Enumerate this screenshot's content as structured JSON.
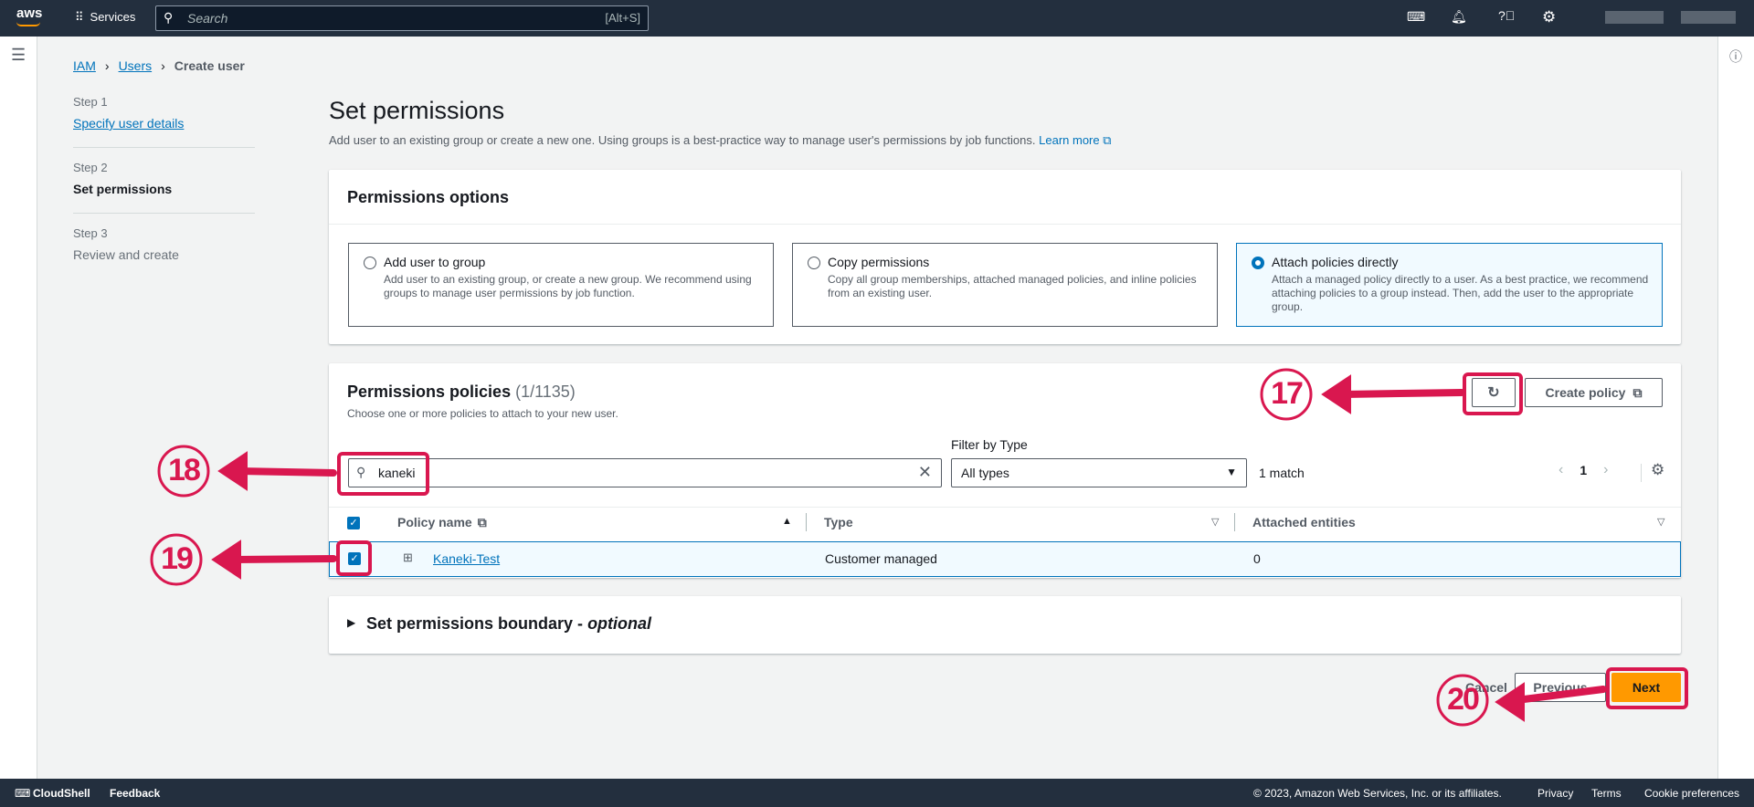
{
  "topnav": {
    "logo": "aws",
    "services": "Services",
    "search_placeholder": "Search",
    "search_shortcut": "[Alt+S]"
  },
  "breadcrumb": [
    "IAM",
    "Users",
    "Create user"
  ],
  "steps": [
    {
      "num": "Step 1",
      "label": "Specify user details"
    },
    {
      "num": "Step 2",
      "label": "Set permissions"
    },
    {
      "num": "Step 3",
      "label": "Review and create"
    }
  ],
  "page": {
    "title": "Set permissions",
    "description": "Add user to an existing group or create a new one. Using groups is a best-practice way to manage user's permissions by job functions.",
    "learn_more": "Learn more"
  },
  "options": {
    "title": "Permissions options",
    "cards": [
      {
        "label": "Add user to group",
        "desc": "Add user to an existing group, or create a new group. We recommend using groups to manage user permissions by job function.",
        "selected": false
      },
      {
        "label": "Copy permissions",
        "desc": "Copy all group memberships, attached managed policies, and inline policies from an existing user.",
        "selected": false
      },
      {
        "label": "Attach policies directly",
        "desc": "Attach a managed policy directly to a user. As a best practice, we recommend attaching policies to a group instead. Then, add the user to the appropriate group.",
        "selected": true
      }
    ]
  },
  "policies": {
    "title": "Permissions policies",
    "count": "(1/1135)",
    "subtitle": "Choose one or more policies to attach to your new user.",
    "create_policy": "Create policy",
    "filter_label": "Filter by Type",
    "search_value": "kaneki",
    "filter_value": "All types",
    "match": "1 match",
    "page": "1",
    "columns": [
      "Policy name",
      "Type",
      "Attached entities"
    ],
    "rows": [
      {
        "name": "Kaneki-Test",
        "type": "Customer managed",
        "entities": "0",
        "checked": true
      }
    ]
  },
  "boundary": {
    "title": "Set permissions boundary - ",
    "optional": "optional"
  },
  "actions": {
    "cancel": "Cancel",
    "previous": "Previous",
    "next": "Next"
  },
  "footer": {
    "cloudshell": "CloudShell",
    "feedback": "Feedback",
    "copyright": "© 2023, Amazon Web Services, Inc. or its affiliates.",
    "privacy": "Privacy",
    "terms": "Terms",
    "cookies": "Cookie preferences"
  },
  "annotations": [
    "17",
    "18",
    "19",
    "20"
  ],
  "colors": {
    "accent": "#0073bb",
    "primary_button": "#ff9900",
    "annotation": "#d9174f",
    "nav": "#232f3e"
  }
}
